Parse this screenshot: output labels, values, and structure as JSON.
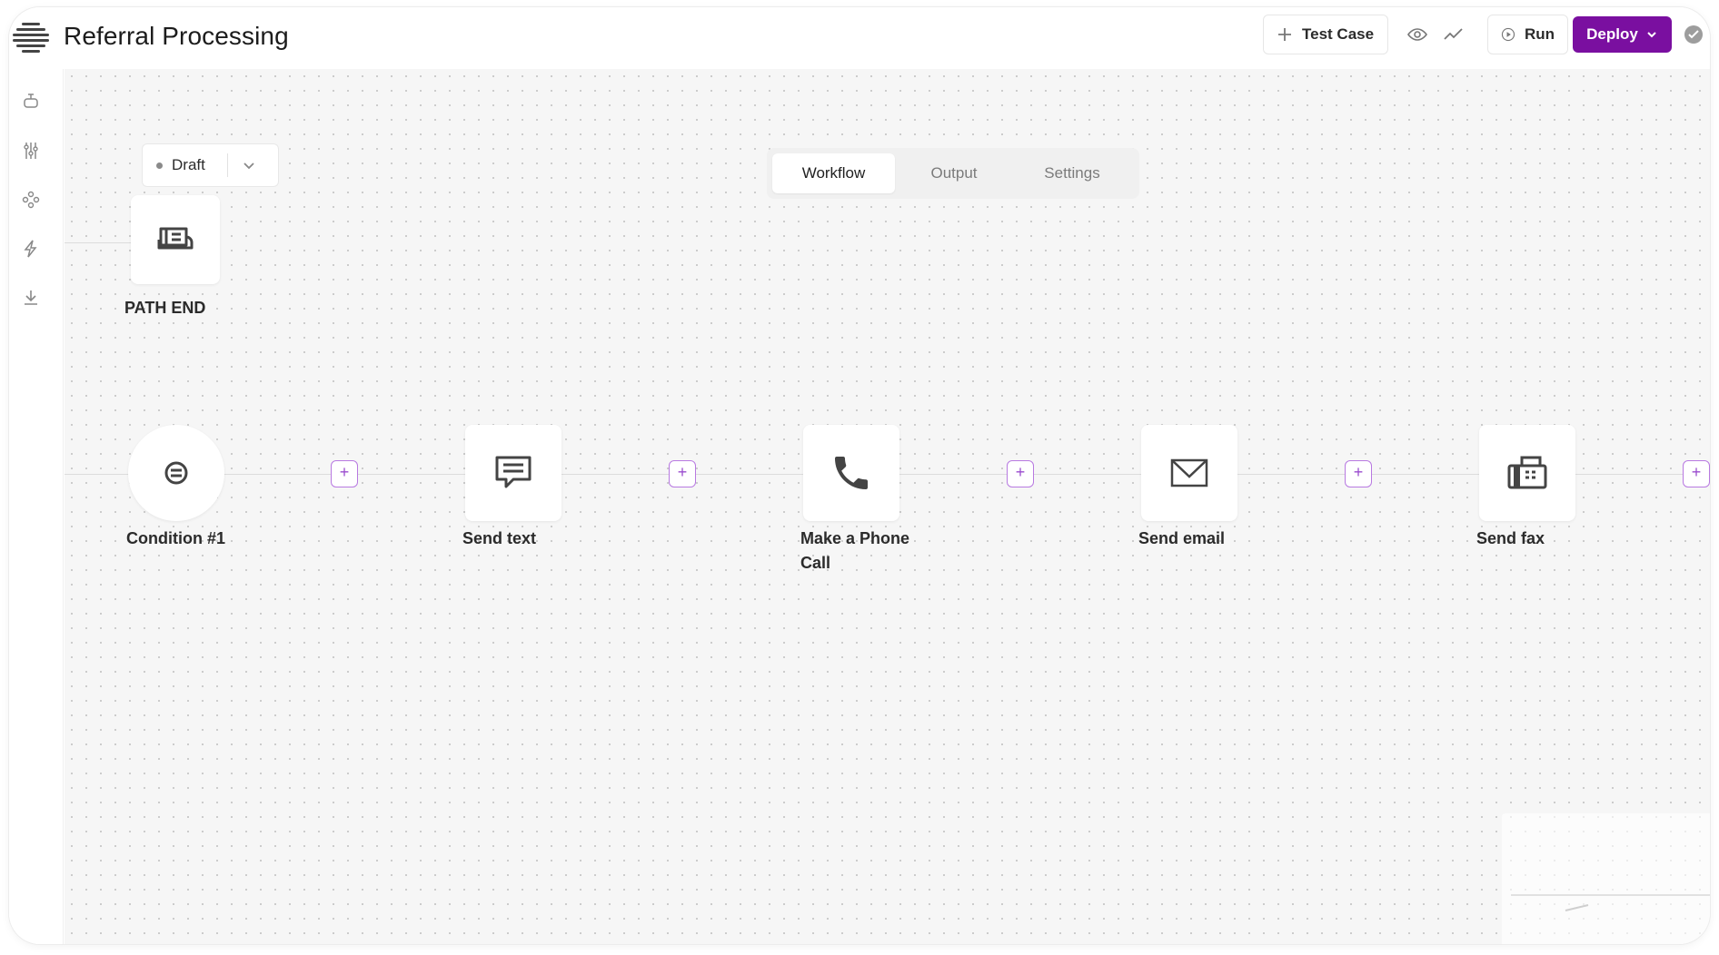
{
  "app": {
    "title": "Referral Processing"
  },
  "header": {
    "test_case": "Test Case",
    "run": "Run",
    "deploy": "Deploy"
  },
  "status": {
    "label": "Draft"
  },
  "tabs": {
    "workflow": "Workflow",
    "output": "Output",
    "settings": "Settings"
  },
  "nodes": {
    "path_end": "PATH END",
    "condition": "Condition #1",
    "send_text": "Send text",
    "phone_line1": "Make a Phone",
    "phone_line2": "Call",
    "send_email": "Send email",
    "send_fax": "Send fax"
  },
  "colors": {
    "accent": "#7a0fa0",
    "plus_border": "#b879e1"
  },
  "icons": {
    "logo": "logo-icon",
    "sidebar": [
      "agent-icon",
      "filter-settings-icon",
      "components-icon",
      "lightning-icon",
      "download-icon"
    ]
  }
}
